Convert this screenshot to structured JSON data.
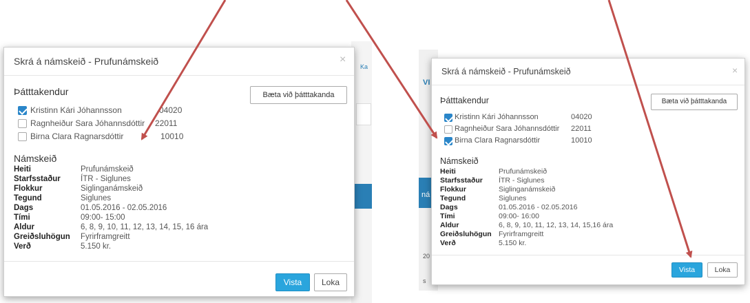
{
  "colors": {
    "accent": "#2aa5dd",
    "checkbox": "#2a86c9",
    "arrow": "#c0504d",
    "page_blue": "#2a7fb5"
  },
  "left_modal": {
    "title": "Skrá á námskeið - Prufunámskeið",
    "close_icon": "×",
    "participants_heading": "Þátttakendur",
    "add_participant_label": "Bæta við þátttakanda",
    "participants": [
      {
        "name": "Kristinn Kári Jóhannsson",
        "id": "04020",
        "checked": true
      },
      {
        "name": "Ragnheiður Sara Jóhannsdóttir",
        "id": "22011",
        "checked": false
      },
      {
        "name": "Birna Clara Ragnarsdóttir",
        "id": "10010",
        "checked": false
      }
    ],
    "course_heading": "Námskeið",
    "info": [
      {
        "label": "Heiti",
        "value": "Prufunámskeið"
      },
      {
        "label": "Starfsstaður",
        "value": "ÍTR - Siglunes"
      },
      {
        "label": "Flokkur",
        "value": "Siglinganámskeið"
      },
      {
        "label": "Tegund",
        "value": "Siglunes"
      },
      {
        "label": "Dags",
        "value": "01.05.2016 - 02.05.2016"
      },
      {
        "label": "Tími",
        "value": "09:00- 15:00"
      },
      {
        "label": "Aldur",
        "value": "6, 8, 9, 10, 11, 12, 13, 14, 15, 16 ára"
      },
      {
        "label": "Greiðsluhögun",
        "value": "Fyrirframgreitt"
      },
      {
        "label": "Verð",
        "value": "5.150 kr."
      }
    ],
    "save_label": "Vista",
    "close_label": "Loka"
  },
  "right_modal": {
    "title": "Skrá á námskeið - Prufunámskeið",
    "close_icon": "×",
    "participants_heading": "Þátttakendur",
    "add_participant_label": "Bæta við þátttakanda",
    "participants": [
      {
        "name": "Kristinn Kári Jóhannsson",
        "id": "04020",
        "checked": true
      },
      {
        "name": "Ragnheiður Sara Jóhannsdóttir",
        "id": "22011",
        "checked": false
      },
      {
        "name": "Birna Clara Ragnarsdóttir",
        "id": "10010",
        "checked": true
      }
    ],
    "course_heading": "Námskeið",
    "info": [
      {
        "label": "Heiti",
        "value": "Prufunámskeið"
      },
      {
        "label": "Starfsstaður",
        "value": "ÍTR - Siglunes"
      },
      {
        "label": "Flokkur",
        "value": "Siglinganámskeið"
      },
      {
        "label": "Tegund",
        "value": "Siglunes"
      },
      {
        "label": "Dags",
        "value": "01.05.2016 - 02.05.2016"
      },
      {
        "label": "Tími",
        "value": "09:00- 16:00"
      },
      {
        "label": "Aldur",
        "value": "6, 8, 9, 10, 11, 12, 13, 14, 15,16 ára"
      },
      {
        "label": "Greiðsluhögun",
        "value": "Fyrirframgreitt"
      },
      {
        "label": "Verð",
        "value": "5.150 kr."
      }
    ],
    "save_label": "Vista",
    "close_label": "Loka"
  },
  "background_fragments": {
    "left_edge_text": "Ka",
    "right_edge_text_a": "VI",
    "right_edge_text_b": "ná",
    "right_edge_text_c": "20",
    "right_edge_text_d": "s"
  }
}
